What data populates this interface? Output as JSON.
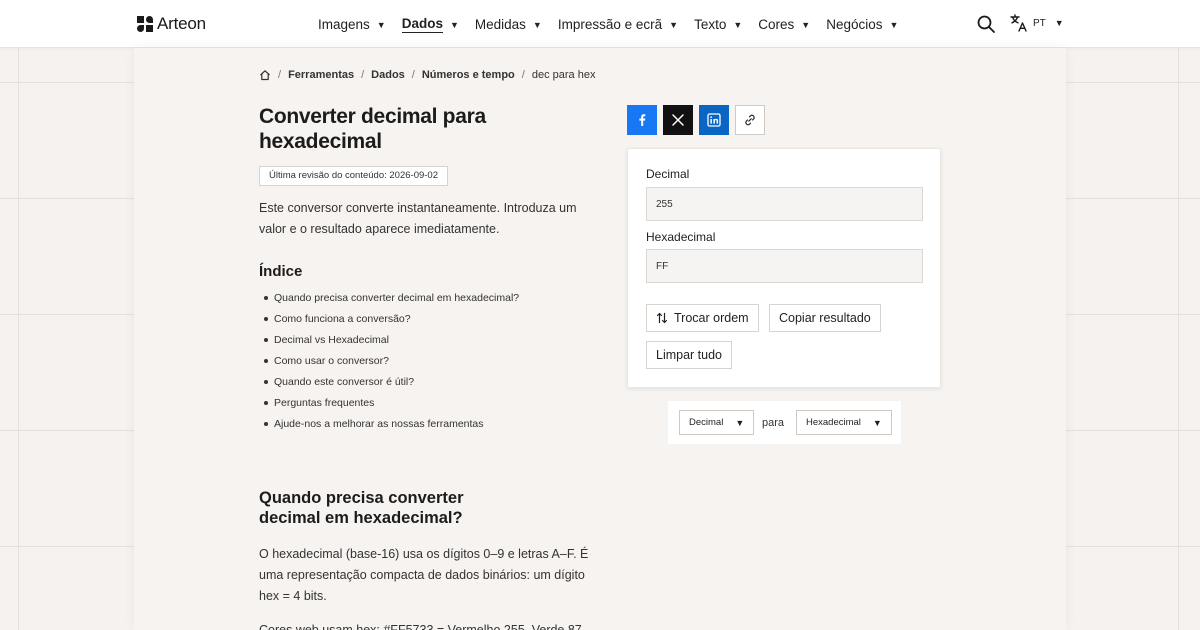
{
  "brand": {
    "name": "Arteon"
  },
  "nav": [
    {
      "label": "Imagens",
      "active": false
    },
    {
      "label": "Dados",
      "active": true
    },
    {
      "label": "Medidas",
      "active": false
    },
    {
      "label": "Impressão e ecrã",
      "active": false
    },
    {
      "label": "Texto",
      "active": false
    },
    {
      "label": "Cores",
      "active": false
    },
    {
      "label": "Negócios",
      "active": false
    }
  ],
  "header": {
    "lang_code": "PT"
  },
  "breadcrumb": [
    "Ferramentas",
    "Dados",
    "Números e tempo",
    "dec para hex"
  ],
  "page": {
    "title": "Converter decimal para hexadecimal",
    "revised": "Última revisão do conteúdo: 2026-09-02",
    "intro": "Este conversor converte instantaneamente. Introduza um valor e o resultado aparece imediatamente."
  },
  "toc": {
    "title": "Índice",
    "items": [
      "Quando precisa converter decimal em hexadecimal?",
      "Como funciona a conversão?",
      "Decimal vs Hexadecimal",
      "Como usar o conversor?",
      "Quando este conversor é útil?",
      "Perguntas frequentes",
      "Ajude-nos a melhorar as nossas ferramentas"
    ]
  },
  "section": {
    "heading": "Quando precisa converter decimal em hexadecimal?",
    "para1": "O hexadecimal (base-16) usa os dígitos 0–9 e letras A–F. É uma representação compacta de dados binários: um dígito hex = 4 bits.",
    "para2": "Cores web usam hex: #FF5733 = Vermelho 255, Verde 87"
  },
  "converter": {
    "input_label": "Decimal",
    "input_value": "255",
    "output_label": "Hexadecimal",
    "output_value": "FF",
    "swap_label": "Trocar ordem",
    "copy_label": "Copiar resultado",
    "clear_label": "Limpar tudo"
  },
  "units": {
    "from": "Decimal",
    "connector": "para",
    "to": "Hexadecimal"
  },
  "colors": {
    "facebook": "#1877f2",
    "x": "#111111",
    "linkedin": "#0a66c2",
    "background": "#f5f2ef"
  }
}
